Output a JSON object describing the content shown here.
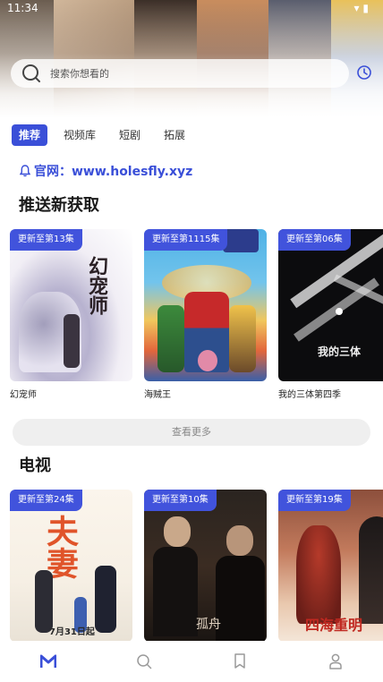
{
  "status_bar": {
    "time": "11:34",
    "icons": "▾ ▮"
  },
  "search": {
    "placeholder": "搜索你想看的"
  },
  "tabs": [
    {
      "label": "推荐",
      "active": true
    },
    {
      "label": "视频库",
      "active": false
    },
    {
      "label": "短剧",
      "active": false
    },
    {
      "label": "拓展",
      "active": false
    }
  ],
  "official_site": {
    "label": "官网：www.holesfly.xyz"
  },
  "sections": {
    "push": {
      "title": "推送新获取",
      "items": [
        {
          "badge": "更新至第13集",
          "title": "幻宠师",
          "poster_text": "幻宠师"
        },
        {
          "badge": "更新至第1115集",
          "title": "海贼王",
          "poster_text": ""
        },
        {
          "badge": "更新至第06集",
          "title": "我的三体第四季",
          "poster_text": "我的三体"
        }
      ],
      "more_label": "查看更多"
    },
    "tv": {
      "title": "电视",
      "items": [
        {
          "badge": "更新至第24集",
          "title": "",
          "poster_text": "夫妻",
          "poster_sub": "7月31日起"
        },
        {
          "badge": "更新至第10集",
          "title": "",
          "poster_text": "孤舟"
        },
        {
          "badge": "更新至第19集",
          "title": "",
          "poster_text": "四海重明"
        }
      ]
    }
  },
  "colors": {
    "accent": "#3a4fd8",
    "badge": "#4153dc",
    "more_bg": "#efefef"
  },
  "bottom_nav": [
    {
      "icon": "home-logo-icon",
      "active": true
    },
    {
      "icon": "search-icon",
      "active": false
    },
    {
      "icon": "bookmark-icon",
      "active": false
    },
    {
      "icon": "user-icon",
      "active": false
    }
  ]
}
